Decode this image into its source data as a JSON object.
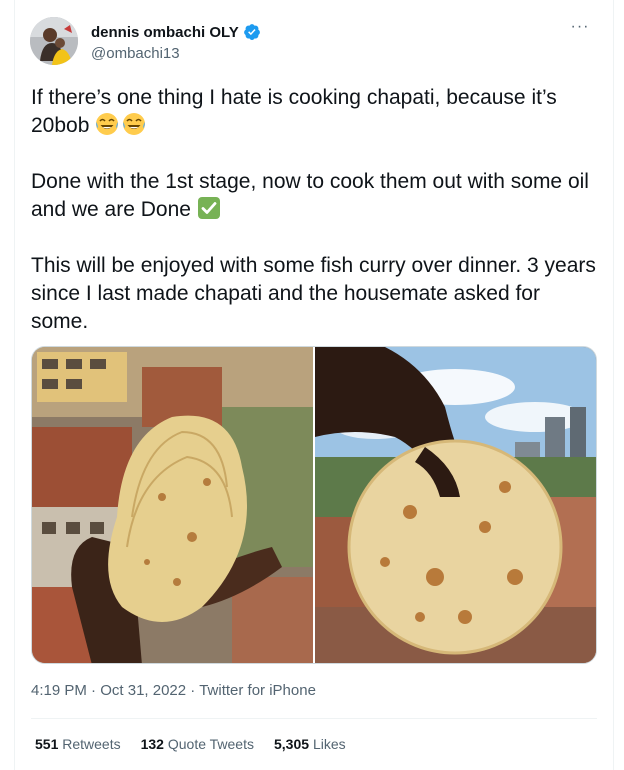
{
  "author": {
    "display_name": "dennis ombachi OLY",
    "handle": "@ombachi13",
    "verified": true
  },
  "tweet": {
    "paragraphs": [
      "If there’s one thing I hate is cooking chapati, because it’s 20bob",
      "Done with the 1st stage, now to cook them out with some oil and we are Done",
      "This will be enjoyed with some fish curry over dinner. 3 years since I last made chapati and the housemate asked for some."
    ],
    "emojis": [
      "face-with-tears-of-joy-icon",
      "face-with-tears-of-joy-icon",
      "check-mark-button-icon"
    ]
  },
  "meta": {
    "time": "4:19 PM",
    "separator": "·",
    "date": "Oct 31, 2022",
    "source": "Twitter for iPhone"
  },
  "stats": {
    "retweets_count": "551",
    "retweets_label": "Retweets",
    "quotes_count": "132",
    "quotes_label": "Quote Tweets",
    "likes_count": "5,305",
    "likes_label": "Likes"
  },
  "colors": {
    "text": "#0f1419",
    "secondary": "#536471",
    "verified": "#1d9bf0",
    "border": "#eff3f4"
  }
}
